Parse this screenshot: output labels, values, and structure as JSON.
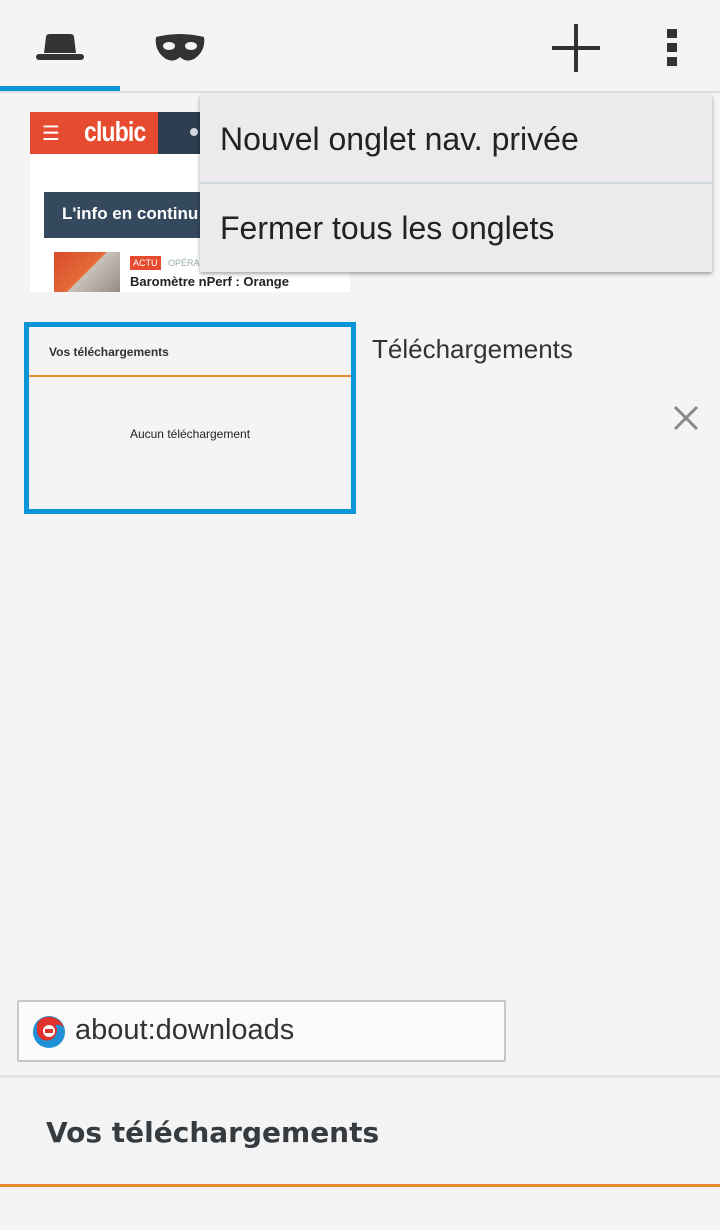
{
  "toolbar": {
    "normal_tabs_icon": "top-hat-icon",
    "private_tabs_icon": "mask-icon",
    "add_icon": "plus-icon",
    "menu_icon": "overflow-menu-icon"
  },
  "menu": {
    "items": [
      {
        "label": "Nouvel onglet nav. privée"
      },
      {
        "label": "Fermer tous les onglets"
      }
    ]
  },
  "tabs": [
    {
      "logo": "clubic",
      "banner": "L'info en continu",
      "tag": "ACTU",
      "category": "OPÉRA",
      "headline": "Baromètre nPerf : Orange"
    },
    {
      "thumb_title": "Vos téléchargements",
      "thumb_empty": "Aucun téléchargement",
      "label": "Téléchargements",
      "close_icon": "close-icon"
    }
  ],
  "urlbar": {
    "url": "about:downloads",
    "icon": "firefox-icon"
  },
  "content": {
    "title": "Vos téléchargements"
  },
  "colors": {
    "accent": "#0996d8",
    "orange": "#e8892b",
    "clubic_red": "#e64b2f"
  }
}
